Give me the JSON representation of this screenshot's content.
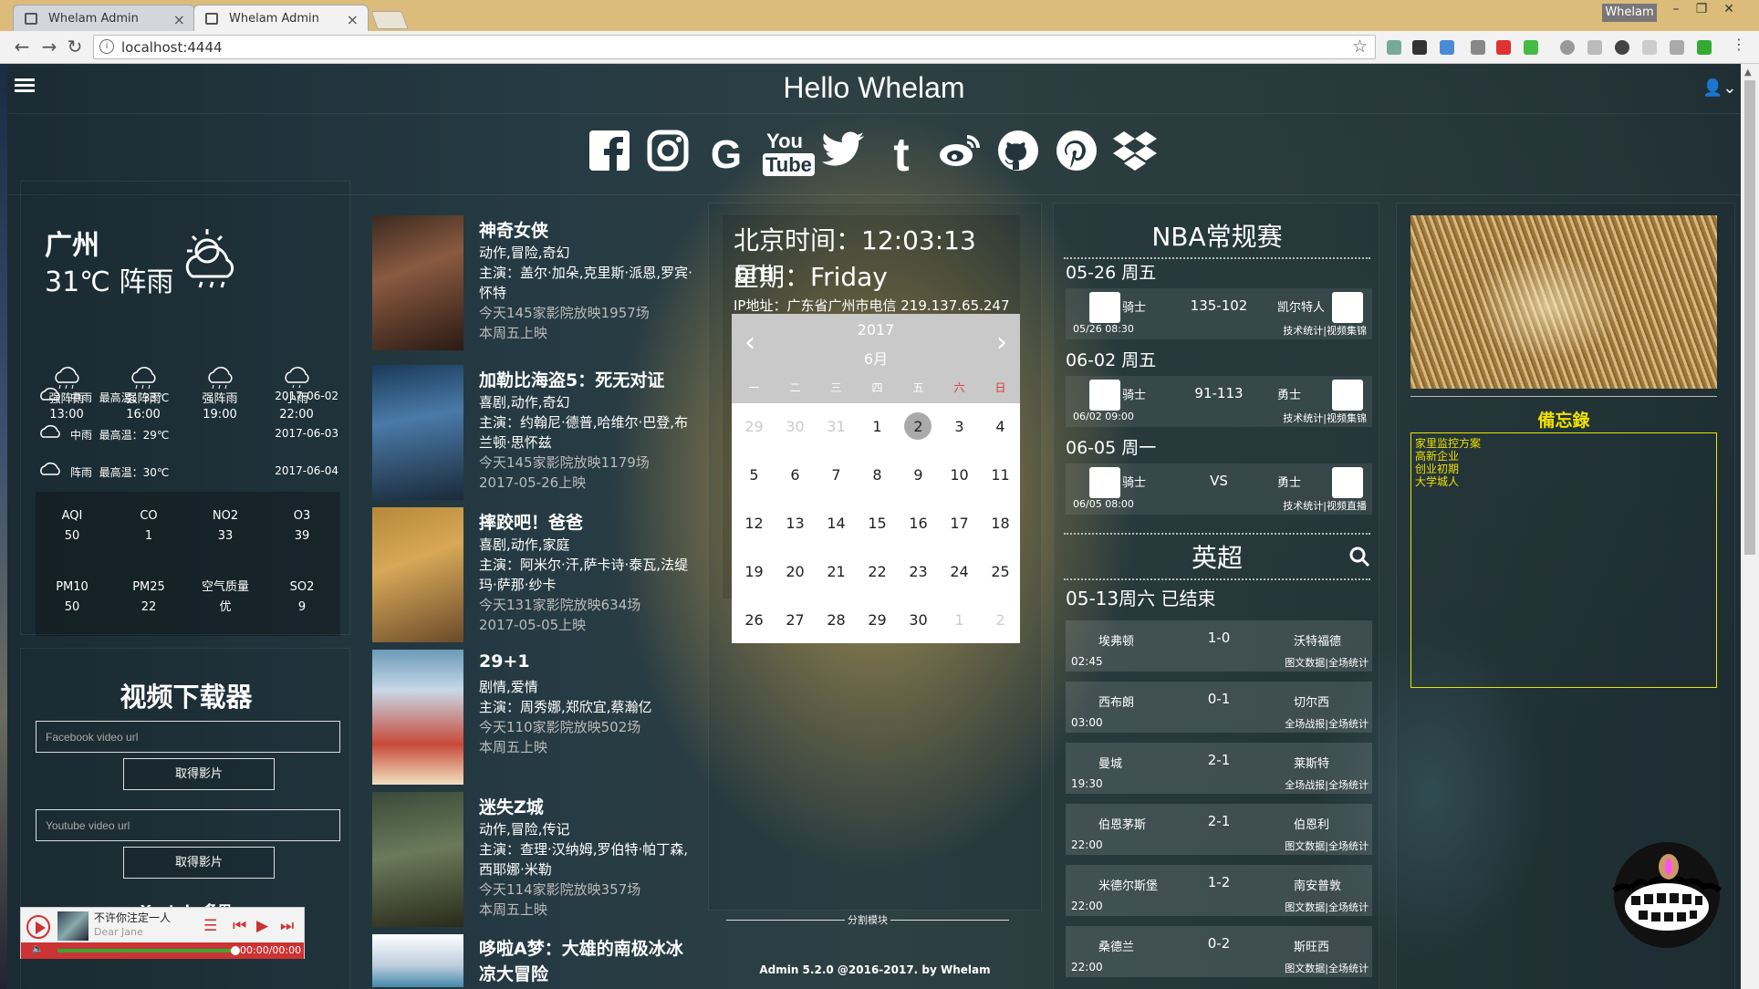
{
  "browser": {
    "tabs": [
      "Whelam Admin",
      "Whelam Admin"
    ],
    "url": "localhost:4444",
    "user_chip": "Whelam"
  },
  "header": {
    "title": "Hello Whelam"
  },
  "social": [
    "facebook-icon",
    "instagram-icon",
    "google-icon",
    "youtube-icon",
    "twitter-icon",
    "tumblr-icon",
    "weibo-icon",
    "github-icon",
    "pinterest-icon",
    "dropbox-icon"
  ],
  "weather": {
    "city": "广州",
    "now": "31℃ 阵雨",
    "hourly": [
      {
        "cond": "强阵雨",
        "time": "13:00"
      },
      {
        "cond": "强阵雨",
        "time": "16:00"
      },
      {
        "cond": "强阵雨",
        "time": "19:00"
      },
      {
        "cond": "小雨",
        "time": "22:00"
      }
    ],
    "daily": [
      {
        "cond": "中雨",
        "high": "最高温：33℃",
        "date": "2017-06-02"
      },
      {
        "cond": "中雨",
        "high": "最高温：29℃",
        "date": "2017-06-03"
      },
      {
        "cond": "阵雨",
        "high": "最高温：30℃",
        "date": "2017-06-04"
      }
    ],
    "aqi": [
      {
        "label": "AQI",
        "value": "50"
      },
      {
        "label": "CO",
        "value": "1"
      },
      {
        "label": "NO2",
        "value": "33"
      },
      {
        "label": "O3",
        "value": "39"
      },
      {
        "label": "PM10",
        "value": "50"
      },
      {
        "label": "PM25",
        "value": "22"
      },
      {
        "label": "空气质量",
        "value": "优"
      },
      {
        "label": "SO2",
        "value": "9"
      }
    ]
  },
  "video_downloader": {
    "title": "视频下载器",
    "fb_placeholder": "Facebook video url",
    "yt_placeholder": "Youtube video url",
    "button": "取得影片",
    "backup": "Youtube备用"
  },
  "player": {
    "title": "不许你注定一人",
    "artist": "Dear Jane",
    "time": "00:00/00:00",
    "progress": 1.0
  },
  "movies": [
    {
      "title": "神奇女侠",
      "genre": "动作,冒险,奇幻",
      "cast": "主演：盖尔·加朵,克里斯·派恩,罗宾·怀特",
      "stat": "今天145家影院放映1957场",
      "release": "本周五上映"
    },
    {
      "title": "加勒比海盗5：死无对证",
      "genre": "喜剧,动作,奇幻",
      "cast": "主演：约翰尼·德普,哈维尔·巴登,布兰顿·思怀兹",
      "stat": "今天145家影院放映1179场",
      "release": "2017-05-26上映"
    },
    {
      "title": "摔跤吧！爸爸",
      "genre": "喜剧,动作,家庭",
      "cast": "主演：阿米尔·汗,萨卡诗·泰瓦,法缇玛·萨那·纱卡",
      "stat": "今天131家影院放映634场",
      "release": "2017-05-05上映"
    },
    {
      "title": "29+1",
      "genre": "剧情,爱情",
      "cast": "主演：周秀娜,郑欣宜,蔡瀚亿",
      "stat": "今天110家影院放映502场",
      "release": "本周五上映"
    },
    {
      "title": "迷失Z城",
      "genre": "动作,冒险,传记",
      "cast": "主演：查理·汉纳姆,罗伯特·帕丁森,西耶娜·米勒",
      "stat": "今天114家影院放映357场",
      "release": "本周五上映"
    },
    {
      "title": "哆啦A梦：大雄的南极冰冰凉大冒险",
      "genre": "",
      "cast": "",
      "stat": "",
      "release": ""
    }
  ],
  "clock": {
    "time": "北京时间：12:03:13 pm",
    "day": "星期：Friday",
    "ip": "IP地址：广东省广州市电信 219.137.65.247"
  },
  "calendar": {
    "year": "2017",
    "month": "6月",
    "weekdays": [
      "一",
      "二",
      "三",
      "四",
      "五",
      "六",
      "日"
    ],
    "weeks": [
      [
        "29",
        "30",
        "31",
        "1",
        "2",
        "3",
        "4"
      ],
      [
        "5",
        "6",
        "7",
        "8",
        "9",
        "10",
        "11"
      ],
      [
        "12",
        "13",
        "14",
        "15",
        "16",
        "17",
        "18"
      ],
      [
        "19",
        "20",
        "21",
        "22",
        "23",
        "24",
        "25"
      ],
      [
        "26",
        "27",
        "28",
        "29",
        "30",
        "1",
        "2"
      ]
    ],
    "selected": "2"
  },
  "divider_label": "分割模块",
  "footer": "Admin 5.2.0 @2016-2017. by Whelam",
  "nba": {
    "title": "NBA常规赛",
    "days": [
      {
        "date": "05-26 周五",
        "home": "骑士",
        "score": "135-102",
        "away": "凯尔特人",
        "time": "05/26 08:30",
        "link": "技术统计|视频集锦"
      },
      {
        "date": "06-02 周五",
        "home": "骑士",
        "score": "91-113",
        "away": "勇士",
        "time": "06/02 09:00",
        "link": "技术统计|视频集锦"
      },
      {
        "date": "06-05 周一",
        "home": "骑士",
        "score": "VS",
        "away": "勇士",
        "time": "06/05 08:00",
        "link": "技术统计|视频直播"
      }
    ]
  },
  "epl": {
    "title": "英超",
    "date": "05-13周六 已结束",
    "games": [
      {
        "home": "埃弗顿",
        "score": "1-0",
        "away": "沃特福德",
        "time": "02:45",
        "link": "图文数据|全场统计"
      },
      {
        "home": "西布朗",
        "score": "0-1",
        "away": "切尔西",
        "time": "03:00",
        "link": "全场战报|全场统计"
      },
      {
        "home": "曼城",
        "score": "2-1",
        "away": "莱斯特",
        "time": "19:30",
        "link": "全场战报|全场统计"
      },
      {
        "home": "伯恩茅斯",
        "score": "2-1",
        "away": "伯恩利",
        "time": "22:00",
        "link": "图文数据|全场统计"
      },
      {
        "home": "米德尔斯堡",
        "score": "1-2",
        "away": "南安普敦",
        "time": "22:00",
        "link": "图文数据|全场统计"
      },
      {
        "home": "桑德兰",
        "score": "0-2",
        "away": "斯旺西",
        "time": "22:00",
        "link": "图文数据|全场统计"
      }
    ]
  },
  "memo": {
    "title": "備忘錄",
    "lines": [
      "家里监控方案",
      "高新企业",
      "创业初期",
      "大学城人"
    ]
  }
}
